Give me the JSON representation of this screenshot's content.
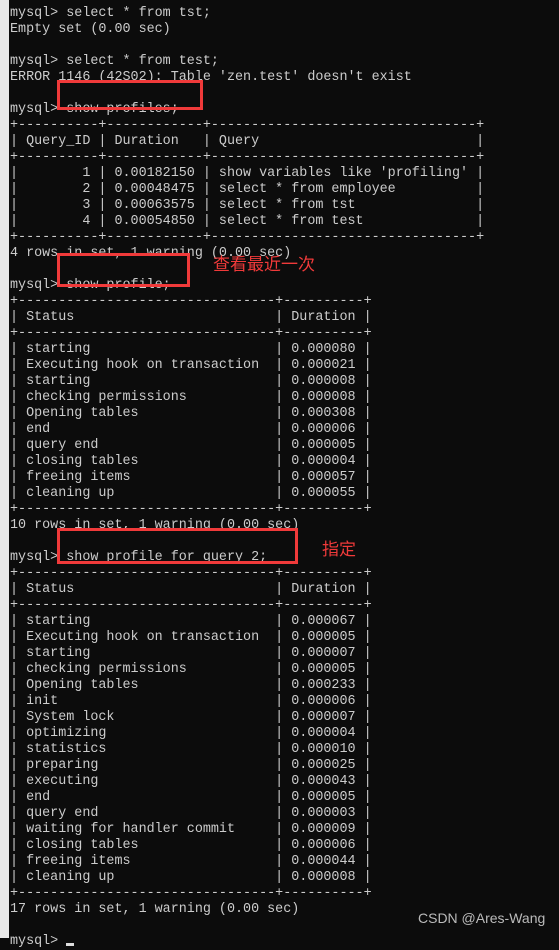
{
  "session": [
    {
      "prompt": "mysql> ",
      "command": "select * from tst;",
      "output": [
        "Empty set (0.00 sec)"
      ]
    },
    {
      "prompt": "mysql> ",
      "command": "select * from test;",
      "output": [
        "ERROR 1146 (42S02): Table 'zen.test' doesn't exist"
      ]
    },
    {
      "prompt": "mysql> ",
      "command": "show profiles;",
      "table": {
        "columns": [
          "Query_ID",
          "Duration",
          "Query"
        ],
        "align": [
          "right",
          "left",
          "left"
        ],
        "rows": [
          [
            "1",
            "0.00182150",
            "show variables like 'profiling'"
          ],
          [
            "2",
            "0.00048475",
            "select * from employee"
          ],
          [
            "3",
            "0.00063575",
            "select * from tst"
          ],
          [
            "4",
            "0.00054850",
            "select * from test"
          ]
        ]
      },
      "summary": "4 rows in set, 1 warning (0.00 sec)"
    },
    {
      "prompt": "mysql> ",
      "command": "show profile;",
      "table": {
        "columns": [
          "Status",
          "Duration"
        ],
        "align": [
          "left",
          "left"
        ],
        "min": [
          30,
          8
        ],
        "rows": [
          [
            "starting",
            "0.000080"
          ],
          [
            "Executing hook on transaction",
            "0.000021"
          ],
          [
            "starting",
            "0.000008"
          ],
          [
            "checking permissions",
            "0.000008"
          ],
          [
            "Opening tables",
            "0.000308"
          ],
          [
            "end",
            "0.000006"
          ],
          [
            "query end",
            "0.000005"
          ],
          [
            "closing tables",
            "0.000004"
          ],
          [
            "freeing items",
            "0.000057"
          ],
          [
            "cleaning up",
            "0.000055"
          ]
        ]
      },
      "summary": "10 rows in set, 1 warning (0.00 sec)"
    },
    {
      "prompt": "mysql> ",
      "command": "show profile for query 2;",
      "table": {
        "columns": [
          "Status",
          "Duration"
        ],
        "align": [
          "left",
          "left"
        ],
        "min": [
          30,
          8
        ],
        "rows": [
          [
            "starting",
            "0.000067"
          ],
          [
            "Executing hook on transaction",
            "0.000005"
          ],
          [
            "starting",
            "0.000007"
          ],
          [
            "checking permissions",
            "0.000005"
          ],
          [
            "Opening tables",
            "0.000233"
          ],
          [
            "init",
            "0.000006"
          ],
          [
            "System lock",
            "0.000007"
          ],
          [
            "optimizing",
            "0.000004"
          ],
          [
            "statistics",
            "0.000010"
          ],
          [
            "preparing",
            "0.000025"
          ],
          [
            "executing",
            "0.000043"
          ],
          [
            "end",
            "0.000005"
          ],
          [
            "query end",
            "0.000003"
          ],
          [
            "waiting for handler commit",
            "0.000009"
          ],
          [
            "closing tables",
            "0.000006"
          ],
          [
            "freeing items",
            "0.000044"
          ],
          [
            "cleaning up",
            "0.000008"
          ]
        ]
      },
      "summary": "17 rows in set, 1 warning (0.00 sec)"
    }
  ],
  "final_prompt": "mysql> ",
  "annotations": {
    "latest": "查看最近一次",
    "specific": "指定",
    "color": "#f03a3a"
  },
  "watermark": "CSDN @Ares-Wang"
}
